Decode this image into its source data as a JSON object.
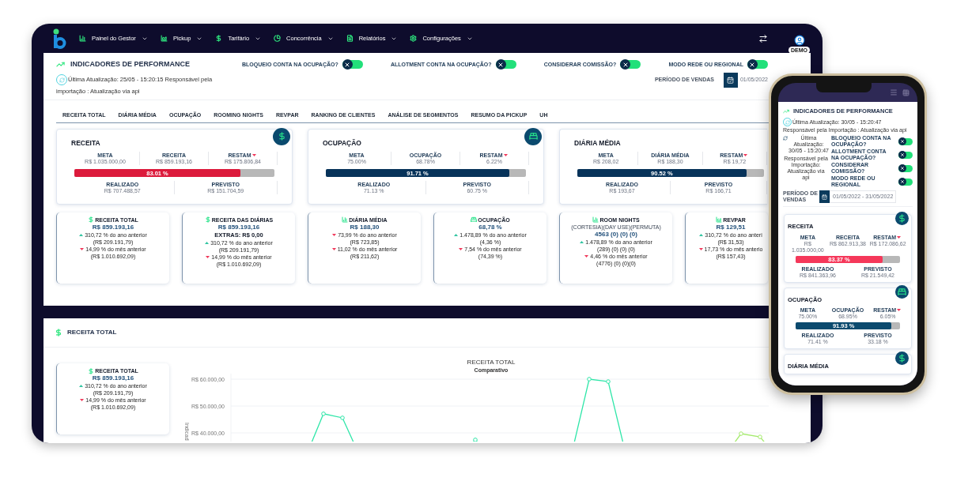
{
  "nav": {
    "items": [
      {
        "label": "Painel do Gestor"
      },
      {
        "label": "Pickup"
      },
      {
        "label": "Tarifário"
      },
      {
        "label": "Concorrência"
      },
      {
        "label": "Relatórios"
      },
      {
        "label": "Configurações"
      }
    ],
    "badge": "DEMO"
  },
  "desktop": {
    "title": "INDICADORES DE PERFORMANCE",
    "toggles": [
      {
        "label": "BLOQUEIO CONTA NA OCUPAÇÃO?",
        "on": false
      },
      {
        "label": "ALLOTMENT CONTA NA OCUPAÇÃO?",
        "on": false
      },
      {
        "label": "CONSIDERAR COMISSÃO?",
        "on": false
      },
      {
        "label": "MODO REDE OU REGIONAL",
        "on": false
      }
    ],
    "update_line_1": "Última Atualização: 25/05 - 15:20:15 Responsável pela",
    "update_line_2": "importação : Atualização via api",
    "period_label": "PERÍODO DE VENDAS",
    "period_value": "01/05/2022",
    "tabs": [
      {
        "label": "RECEITA TOTAL",
        "selected": false
      },
      {
        "label": "DIÁRIA MÉDIA",
        "selected": false
      },
      {
        "label": "OCUPAÇÃO",
        "selected": false
      },
      {
        "label": "ROOMING NIGHTS",
        "selected": false
      },
      {
        "label": "REVPAR",
        "selected": false
      },
      {
        "label": "RANKING DE CLIENTES",
        "selected": false
      },
      {
        "label": "ANÁLISE DE SEGMENTOS",
        "selected": false
      },
      {
        "label": "RESUMO DA PICKUP",
        "selected": false
      },
      {
        "label": "UH",
        "selected": false
      }
    ],
    "big_cards": [
      {
        "title": "RECEITA",
        "kind": "revenue",
        "metrics": [
          {
            "label": "META",
            "value": "R$ 1.035.000,00"
          },
          {
            "label": "RECEITA",
            "value": "R$ 859.193,16"
          },
          {
            "label": "RESTAM",
            "value": "R$ 175.806,84"
          }
        ],
        "progress": {
          "level": 0.8301,
          "label": "83.01 %",
          "color": "#dc1b3c"
        },
        "realized": {
          "label": "REALIZADO",
          "value": "R$ 707.488,57"
        },
        "forecast": {
          "label": "PREVISTO",
          "value": "R$ 151.704,59"
        }
      },
      {
        "title": "OCUPAÇÃO",
        "kind": "occupancy",
        "metrics": [
          {
            "label": "META",
            "value": "75.00%"
          },
          {
            "label": "OCUPAÇÃO",
            "value": "68.78%"
          },
          {
            "label": "RESTAM",
            "value": "6.22%"
          }
        ],
        "progress": {
          "level": 0.9171,
          "label": "91.71 %",
          "color": "#07335a"
        },
        "realized": {
          "label": "REALIZADO",
          "value": "71.13 %"
        },
        "forecast": {
          "label": "PREVISTO",
          "value": "60.75 %"
        }
      },
      {
        "title": "DIÁRIA MÉDIA",
        "kind": "rate",
        "metrics": [
          {
            "label": "META",
            "value": "R$ 208,02"
          },
          {
            "label": "DIÁRIA MÉDIA",
            "value": "R$ 188,30"
          },
          {
            "label": "RESTAM",
            "value": "R$ 19,72"
          }
        ],
        "progress": {
          "level": 0.9052,
          "label": "90.52 %",
          "color": "#07335a"
        },
        "realized": {
          "label": "REALIZADO",
          "value": "R$ 193,67"
        },
        "forecast": {
          "label": "PREVISTO",
          "value": "R$ 166,71"
        }
      }
    ],
    "small_cards": [
      {
        "title": "RECEITA TOTAL",
        "kind": "revenue",
        "value": "R$ 859.193,16",
        "lines": [
          {
            "text": "310,72 % do ano anterior",
            "kind": "up"
          },
          {
            "text": "(R$ 209.191,79)",
            "kind": "plain"
          },
          {
            "text": "14,99 % do mês anterior",
            "kind": "down"
          },
          {
            "text": "(R$ 1.010.692,09)",
            "kind": "plain"
          }
        ]
      },
      {
        "title": "RECEITA DAS DIÁRIAS",
        "kind": "revenue",
        "value": "R$ 859.193,16",
        "extra": "EXTRAS: R$ 0,00",
        "lines": [
          {
            "text": "310,72 % do ano anterior",
            "kind": "up"
          },
          {
            "text": "(R$ 209.191,79)",
            "kind": "plain"
          },
          {
            "text": "14,99 % do mês anterior",
            "kind": "down"
          },
          {
            "text": "(R$ 1.010.692,09)",
            "kind": "plain"
          }
        ]
      },
      {
        "title": "DIÁRIA MÉDIA",
        "kind": "rate",
        "value": "R$ 188,30",
        "lines": [
          {
            "text": "73,99 % do ano anterior",
            "kind": "down"
          },
          {
            "text": "(R$ 723,85)",
            "kind": "plain"
          },
          {
            "text": "11,02 % do mês anterior",
            "kind": "down"
          },
          {
            "text": "(R$ 211,62)",
            "kind": "plain"
          }
        ]
      },
      {
        "title": "OCUPAÇÃO",
        "kind": "occupancy",
        "value": "68,78 %",
        "lines": [
          {
            "text": "1.478,89 % do ano anterior",
            "kind": "up"
          },
          {
            "text": "(4,36 %)",
            "kind": "plain"
          },
          {
            "text": "7,54 % do mês anterior",
            "kind": "down"
          },
          {
            "text": "(74,39 %)",
            "kind": "plain"
          }
        ]
      },
      {
        "title": "ROOM NIGHTS",
        "kind": "rate",
        "note": "(CORTESIA)(DAY USE)(PERMUTA)",
        "value": "4563 (0) (0) (0)",
        "lines": [
          {
            "text": "1.478,89 % do ano anterior",
            "kind": "up"
          },
          {
            "text": "(289) (0) (0) (0)",
            "kind": "plain"
          },
          {
            "text": "4,46 % do mês anterior",
            "kind": "down"
          },
          {
            "text": "(4776) (0) (0)(0)",
            "kind": "plain"
          }
        ]
      },
      {
        "title": "REVPAR",
        "kind": "revpar",
        "value": "R$ 129,51",
        "lines": [
          {
            "text": "310,72 % do ano anteri",
            "kind": "up"
          },
          {
            "text": "(R$ 31,53)",
            "kind": "plain"
          },
          {
            "text": "17,73 % do mês anterio",
            "kind": "down"
          },
          {
            "text": "(R$ 157,43)",
            "kind": "plain"
          }
        ]
      }
    ],
    "section": {
      "title": "RECEITA TOTAL",
      "card": {
        "title": "RECEITA TOTAL",
        "kind": "revenue",
        "value": "R$ 859.193,16",
        "lines": [
          {
            "text": "310,72 % do ano anterior",
            "kind": "up"
          },
          {
            "text": "(R$ 209.191,79)",
            "kind": "plain"
          },
          {
            "text": "14,99 % do mês anterior",
            "kind": "down"
          },
          {
            "text": "(R$ 1.010.692,09)",
            "kind": "plain"
          }
        ]
      },
      "chart": {
        "title": "RECEITA TOTAL",
        "subtitle": "Comparativo",
        "ylabel": "Indicad",
        "y_axis_labels": [
          "R$ 60.000,00",
          "R$ 50.000,00",
          "R$ 40.000,00"
        ]
      }
    }
  },
  "phone": {
    "title": "INDICADORES DE PERFORMANCE",
    "update": "Última Atualização: 30/05 - 15:20:47",
    "importer": "Responsável pela Importação : Atualização via api",
    "update_short": "Última Atualização: 30/05 - 15:20:47",
    "importer_short": "Responsável pela Importação: Atualização via api",
    "toggles": [
      {
        "label": "BLOQUEIO CONTA NA OCUPAÇÃO?",
        "on": false
      },
      {
        "label": "ALLOTMENT CONTA NA OCUPAÇÃO?",
        "on": false
      },
      {
        "label": "CONSIDERAR COMISSÃO?",
        "on": false
      },
      {
        "label": "MODO REDE OU REGIONAL",
        "on": false
      }
    ],
    "period_label": "PERÍODO DE VENDAS",
    "period_value": "01/05/2022 - 31/05/2022",
    "cards": [
      {
        "title": "RECEITA",
        "kind": "revenue",
        "metrics": [
          {
            "label": "META",
            "value": "R$ 1.035.000,00"
          },
          {
            "label": "RECEITA",
            "value": "R$ 862.913,38"
          },
          {
            "label": "RESTAM",
            "value": "R$ 172.086,62"
          }
        ],
        "progress": {
          "level": 0.8337,
          "label": "83.37 %",
          "color": "#f5385a"
        },
        "realized": {
          "label": "REALIZADO",
          "value": "R$ 841.363,96"
        },
        "forecast": {
          "label": "PREVISTO",
          "value": "R$ 21.549,42"
        }
      },
      {
        "title": "OCUPAÇÃO",
        "kind": "occupancy",
        "metrics": [
          {
            "label": "META",
            "value": "75.00%"
          },
          {
            "label": "OCUPAÇÃO",
            "value": "68.95%"
          },
          {
            "label": "RESTAM",
            "value": "6.05%"
          }
        ],
        "progress": {
          "level": 0.9193,
          "label": "91.93 %",
          "color": "#0b4a6e"
        },
        "realized": {
          "label": "REALIZADO",
          "value": "71.41 %"
        },
        "forecast": {
          "label": "PREVISTO",
          "value": "33.18 %"
        }
      },
      {
        "title": "DIÁRIA MÉDIA",
        "kind": "rate"
      }
    ]
  }
}
